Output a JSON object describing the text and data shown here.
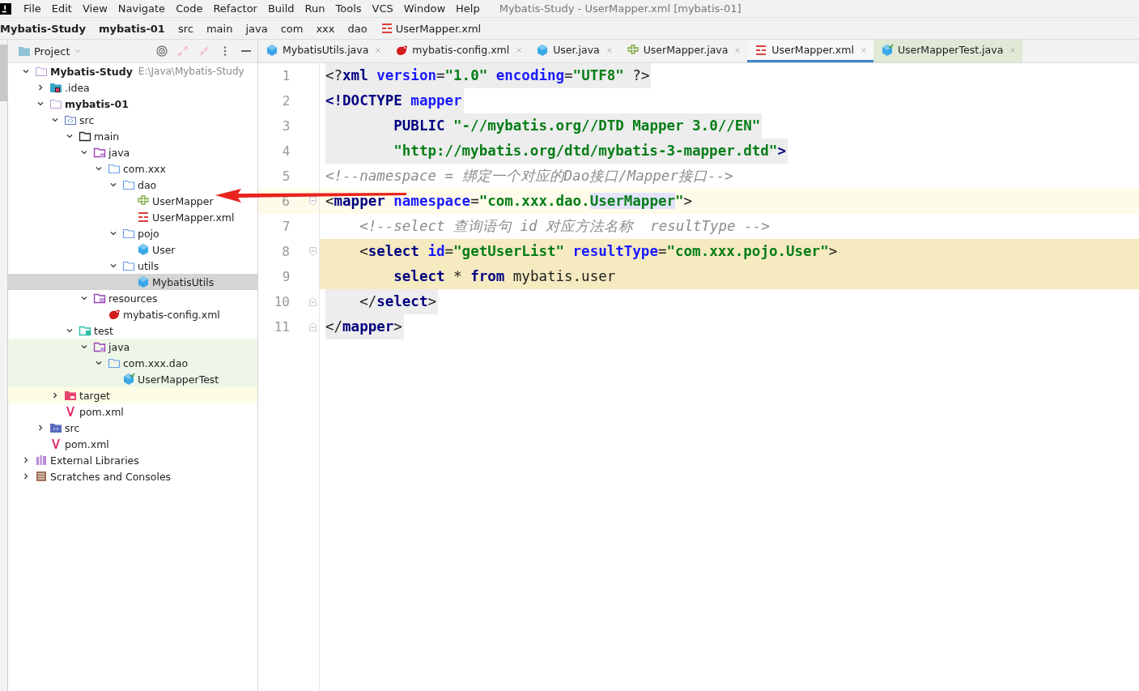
{
  "menu_bar": {
    "items": [
      "File",
      "Edit",
      "View",
      "Navigate",
      "Code",
      "Refactor",
      "Build",
      "Run",
      "Tools",
      "VCS",
      "Window",
      "Help"
    ],
    "title": "Mybatis-Study - UserMapper.xml [mybatis-01]"
  },
  "breadcrumbs": [
    {
      "label": "Mybatis-Study",
      "kind": "module",
      "bold": true
    },
    {
      "label": "mybatis-01",
      "kind": "module",
      "bold": true
    },
    {
      "label": "src",
      "kind": "folder",
      "bold": false
    },
    {
      "label": "main",
      "kind": "folder",
      "bold": false
    },
    {
      "label": "java",
      "kind": "folder",
      "bold": false
    },
    {
      "label": "com",
      "kind": "folder",
      "bold": false
    },
    {
      "label": "xxx",
      "kind": "folder",
      "bold": false
    },
    {
      "label": "dao",
      "kind": "folder",
      "bold": false
    },
    {
      "label": "UserMapper.xml",
      "kind": "xml",
      "bold": false
    }
  ],
  "project_panel": {
    "title": "Project",
    "tree": [
      {
        "label": "Mybatis-Study",
        "hint": "E:\\Java\\Mybatis-Study",
        "kind": "module",
        "bold": true,
        "expanded": true,
        "selected": false,
        "children": [
          {
            "label": ".idea",
            "kind": "idea",
            "expanded": false,
            "selected": false
          },
          {
            "label": "mybatis-01",
            "kind": "module",
            "bold": true,
            "expanded": true,
            "selected": false,
            "children": [
              {
                "label": "src",
                "kind": "source",
                "expanded": true,
                "selected": false,
                "children": [
                  {
                    "label": "main",
                    "kind": "folder",
                    "expanded": true,
                    "selected": false,
                    "children": [
                      {
                        "label": "java",
                        "kind": "javaroot",
                        "expanded": true,
                        "selected": false,
                        "children": [
                          {
                            "label": "com.xxx",
                            "kind": "package",
                            "expanded": true,
                            "selected": false,
                            "children": [
                              {
                                "label": "dao",
                                "kind": "package",
                                "expanded": true,
                                "selected": false,
                                "children": [
                                  {
                                    "label": "UserMapper",
                                    "kind": "interface",
                                    "selected": false
                                  },
                                  {
                                    "label": "UserMapper.xml",
                                    "kind": "xml",
                                    "selected": false
                                  }
                                ]
                              },
                              {
                                "label": "pojo",
                                "kind": "package",
                                "expanded": true,
                                "selected": false,
                                "children": [
                                  {
                                    "label": "User",
                                    "kind": "class",
                                    "selected": false
                                  }
                                ]
                              },
                              {
                                "label": "utils",
                                "kind": "package",
                                "expanded": true,
                                "selected": false,
                                "children": [
                                  {
                                    "label": "MybatisUtils",
                                    "kind": "class",
                                    "selected": true
                                  }
                                ]
                              }
                            ]
                          }
                        ]
                      },
                      {
                        "label": "resources",
                        "kind": "resources",
                        "expanded": true,
                        "selected": false,
                        "children": [
                          {
                            "label": "mybatis-config.xml",
                            "kind": "config",
                            "selected": false
                          }
                        ]
                      }
                    ]
                  },
                  {
                    "label": "test",
                    "kind": "testroot",
                    "expanded": true,
                    "selected": false,
                    "children": [
                      {
                        "label": "java",
                        "kind": "javaroot",
                        "in_test": true,
                        "expanded": true,
                        "selected": false,
                        "children": [
                          {
                            "label": "com.xxx.dao",
                            "kind": "package",
                            "in_test": true,
                            "expanded": true,
                            "selected": false,
                            "children": [
                              {
                                "label": "UserMapperTest",
                                "kind": "testclass",
                                "in_test": true,
                                "selected": false
                              }
                            ]
                          }
                        ]
                      }
                    ]
                  }
                ]
              },
              {
                "label": "target",
                "kind": "excluded",
                "excluded": true,
                "expanded": false,
                "selected": false
              },
              {
                "label": "pom.xml",
                "kind": "maven",
                "selected": false
              }
            ]
          },
          {
            "label": "src",
            "kind": "sourcecollapsed",
            "expanded": false,
            "selected": false
          },
          {
            "label": "pom.xml",
            "kind": "maven",
            "selected": false
          }
        ]
      },
      {
        "label": "External Libraries",
        "kind": "libraries",
        "expanded": false,
        "selected": false
      },
      {
        "label": "Scratches and Consoles",
        "kind": "scratches",
        "expanded": false,
        "selected": false
      }
    ]
  },
  "tabs": [
    {
      "label": "MybatisUtils.java",
      "kind": "class",
      "in_test": false,
      "selected": false
    },
    {
      "label": "mybatis-config.xml",
      "kind": "config",
      "in_test": false,
      "selected": false
    },
    {
      "label": "User.java",
      "kind": "class",
      "in_test": false,
      "selected": false
    },
    {
      "label": "UserMapper.java",
      "kind": "interface",
      "in_test": false,
      "selected": false
    },
    {
      "label": "UserMapper.xml",
      "kind": "xml",
      "in_test": false,
      "selected": true
    },
    {
      "label": "UserMapperTest.java",
      "kind": "testclass",
      "in_test": true,
      "selected": false
    }
  ],
  "editor": {
    "lines": [
      {
        "number": "1",
        "kind": "doc",
        "current": false,
        "tokens": [
          {
            "kind": "punct",
            "text": "<?"
          },
          {
            "kind": "tag",
            "text": "xml"
          },
          {
            "kind": "attr",
            "text": " version"
          },
          {
            "kind": "punct",
            "text": "="
          },
          {
            "kind": "string",
            "text": "\"1.0\""
          },
          {
            "kind": "attr",
            "text": " encoding"
          },
          {
            "kind": "punct",
            "text": "="
          },
          {
            "kind": "string",
            "text": "\"UTF8\""
          },
          {
            "kind": "punct",
            "text": " ?>"
          }
        ]
      },
      {
        "number": "2",
        "kind": "doc",
        "current": false,
        "tokens": [
          {
            "kind": "tag",
            "text": "<!DOCTYPE"
          },
          {
            "kind": "attr",
            "text": " mapper"
          }
        ]
      },
      {
        "number": "3",
        "kind": "doc",
        "current": false,
        "tokens": [
          {
            "kind": "tag",
            "text": "        PUBLIC"
          },
          {
            "kind": "string",
            "text": " \"-//mybatis.org//DTD Mapper 3.0//EN\""
          }
        ]
      },
      {
        "number": "4",
        "kind": "doc",
        "current": false,
        "tokens": [
          {
            "kind": "string",
            "text": "        \"http://mybatis.org/dtd/mybatis-3-mapper.dtd\""
          },
          {
            "kind": "tag",
            "text": ">"
          }
        ]
      },
      {
        "number": "5",
        "kind": "plain",
        "current": false,
        "tokens": [
          {
            "kind": "comment",
            "text": "<!--namespace = 绑定一个对应的Dao接口/Mapper接口-->"
          }
        ]
      },
      {
        "number": "6",
        "kind": "plain",
        "current": true,
        "fold_start": true,
        "tokens": [
          {
            "kind": "punct",
            "text": "<"
          },
          {
            "kind": "tag",
            "text": "mapper"
          },
          {
            "kind": "attr",
            "text": " namespace"
          },
          {
            "kind": "punct",
            "text": "="
          },
          {
            "kind": "string",
            "text": "\"com.xxx.dao."
          },
          {
            "kind": "match",
            "text": "UserMapper"
          },
          {
            "kind": "string",
            "text": "\""
          },
          {
            "kind": "punct",
            "text": ">"
          }
        ]
      },
      {
        "number": "7",
        "kind": "plain",
        "current": false,
        "tokens": [
          {
            "kind": "comment",
            "text": "    <!--select 查询语句 id 对应方法名称  resultType -->"
          }
        ]
      },
      {
        "number": "8",
        "kind": "sql",
        "current": false,
        "fold_start": true,
        "tokens": [
          {
            "kind": "punct",
            "text": "    <"
          },
          {
            "kind": "tag",
            "text": "select"
          },
          {
            "kind": "attr",
            "text": " id"
          },
          {
            "kind": "punct",
            "text": "="
          },
          {
            "kind": "string",
            "text": "\"getUserList\""
          },
          {
            "kind": "attr",
            "text": " resultType"
          },
          {
            "kind": "punct",
            "text": "="
          },
          {
            "kind": "string",
            "text": "\"com.xxx.pojo.User\""
          },
          {
            "kind": "punct",
            "text": ">"
          }
        ]
      },
      {
        "number": "9",
        "kind": "sql",
        "current": false,
        "tokens": [
          {
            "kind": "keyword",
            "text": "        select"
          },
          {
            "kind": "plain",
            "text": " * "
          },
          {
            "kind": "keyword",
            "text": "from"
          },
          {
            "kind": "plain",
            "text": " mybatis.user"
          }
        ]
      },
      {
        "number": "10",
        "kind": "doc",
        "current": false,
        "fold_end": true,
        "tokens": [
          {
            "kind": "punct",
            "text": "    </"
          },
          {
            "kind": "tag",
            "text": "select"
          },
          {
            "kind": "punct",
            "text": ">"
          }
        ]
      },
      {
        "number": "11",
        "kind": "doc",
        "current": false,
        "fold_end": true,
        "tokens": [
          {
            "kind": "punct",
            "text": "</"
          },
          {
            "kind": "tag",
            "text": "mapper"
          },
          {
            "kind": "punct",
            "text": ">"
          }
        ]
      }
    ]
  },
  "annotation": {
    "kind": "arrow"
  }
}
